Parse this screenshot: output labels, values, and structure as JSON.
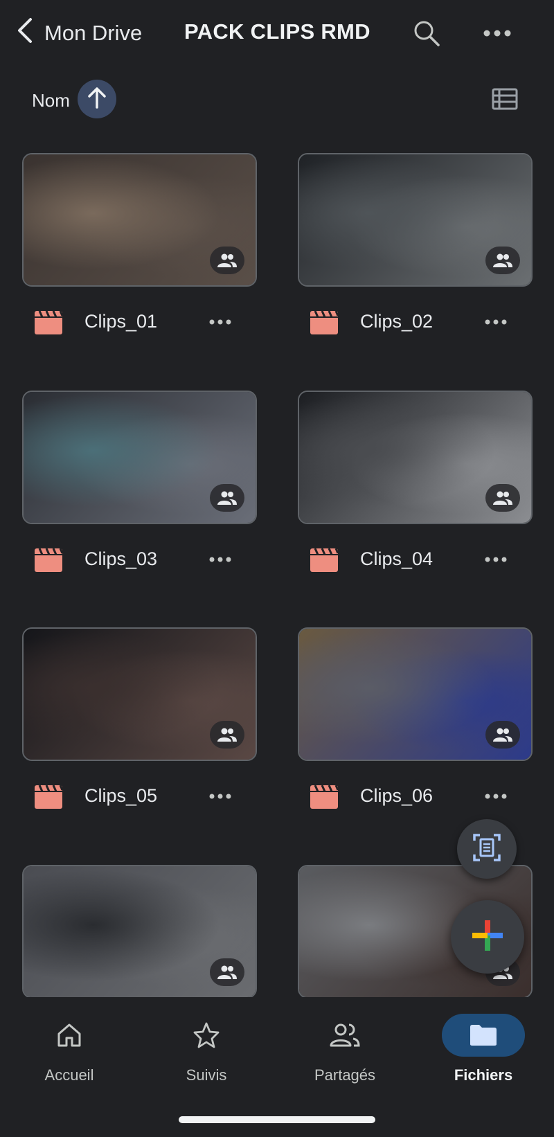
{
  "header": {
    "back_label": "Mon Drive",
    "title": "PACK CLIPS RMD",
    "icons": [
      "chevron-left-icon",
      "search-icon",
      "more-horiz-icon"
    ]
  },
  "sort": {
    "label": "Nom",
    "direction": "ascending",
    "icons": [
      "arrow-up-icon",
      "list-view-icon"
    ]
  },
  "files": [
    {
      "name": "Clips_01",
      "type": "video",
      "shared": true,
      "thumb_colors": [
        "#3a3330",
        "#7a6a5c",
        "#5a4f48"
      ]
    },
    {
      "name": "Clips_02",
      "type": "video",
      "shared": true,
      "thumb_colors": [
        "#1f2226",
        "#4f5458",
        "#6b6f72"
      ]
    },
    {
      "name": "Clips_03",
      "type": "video",
      "shared": true,
      "thumb_colors": [
        "#2a2d33",
        "#4b6f78",
        "#6a6e78"
      ]
    },
    {
      "name": "Clips_04",
      "type": "video",
      "shared": true,
      "thumb_colors": [
        "#1c1e22",
        "#4a4c50",
        "#8c8e92"
      ]
    },
    {
      "name": "Clips_05",
      "type": "video",
      "shared": true,
      "thumb_colors": [
        "#15161a",
        "#3a2f2e",
        "#5a4844"
      ]
    },
    {
      "name": "Clips_06",
      "type": "video",
      "shared": true,
      "thumb_colors": [
        "#6a5a40",
        "#5a5c66",
        "#2c3a8a"
      ]
    },
    {
      "name": "",
      "type": "video",
      "shared": true,
      "thumb_colors": [
        "#4a4c52",
        "#2a2c30",
        "#6a6c70"
      ]
    },
    {
      "name": "",
      "type": "video",
      "shared": true,
      "thumb_colors": [
        "#5a5c60",
        "#7a7c80",
        "#3a2e2c"
      ]
    }
  ],
  "fab": {
    "scan_icon": "document-scan-icon",
    "new_icon": "plus-multicolor-icon"
  },
  "nav": [
    {
      "label": "Accueil",
      "icon": "home-icon",
      "active": false
    },
    {
      "label": "Suivis",
      "icon": "star-icon",
      "active": false
    },
    {
      "label": "Partagés",
      "icon": "people-icon",
      "active": false
    },
    {
      "label": "Fichiers",
      "icon": "folder-icon",
      "active": true
    }
  ],
  "colors": {
    "background": "#202124",
    "file_icon": "#ee8e80",
    "active_nav_pill": "#1f4d7a",
    "active_folder": "#d3e3fd",
    "sort_button": "#3c4a66"
  }
}
